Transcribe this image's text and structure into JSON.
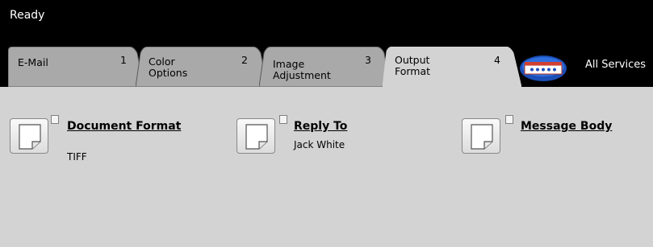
{
  "status": {
    "text": "Ready"
  },
  "tabs": [
    {
      "label": "E-Mail",
      "number": "1",
      "active": false
    },
    {
      "label": "Color\nOptions",
      "number": "2",
      "active": false
    },
    {
      "label": "Image\nAdjustment",
      "number": "3",
      "active": false
    },
    {
      "label": "Output\nFormat",
      "number": "4",
      "active": true
    }
  ],
  "all_services": {
    "label": "All Services",
    "icon": "all-services-icon"
  },
  "items": [
    {
      "title": "Document Format",
      "value": "TIFF",
      "icon": "document-icon"
    },
    {
      "title": "Reply To",
      "value": "Jack White",
      "icon": "document-icon"
    },
    {
      "title": "Message Body",
      "value": "",
      "icon": "document-icon"
    }
  ],
  "colors": {
    "tab_inactive": "#a9a9a9",
    "tab_active": "#d3d3d3",
    "panel": "#d3d3d3",
    "background": "#000000"
  }
}
